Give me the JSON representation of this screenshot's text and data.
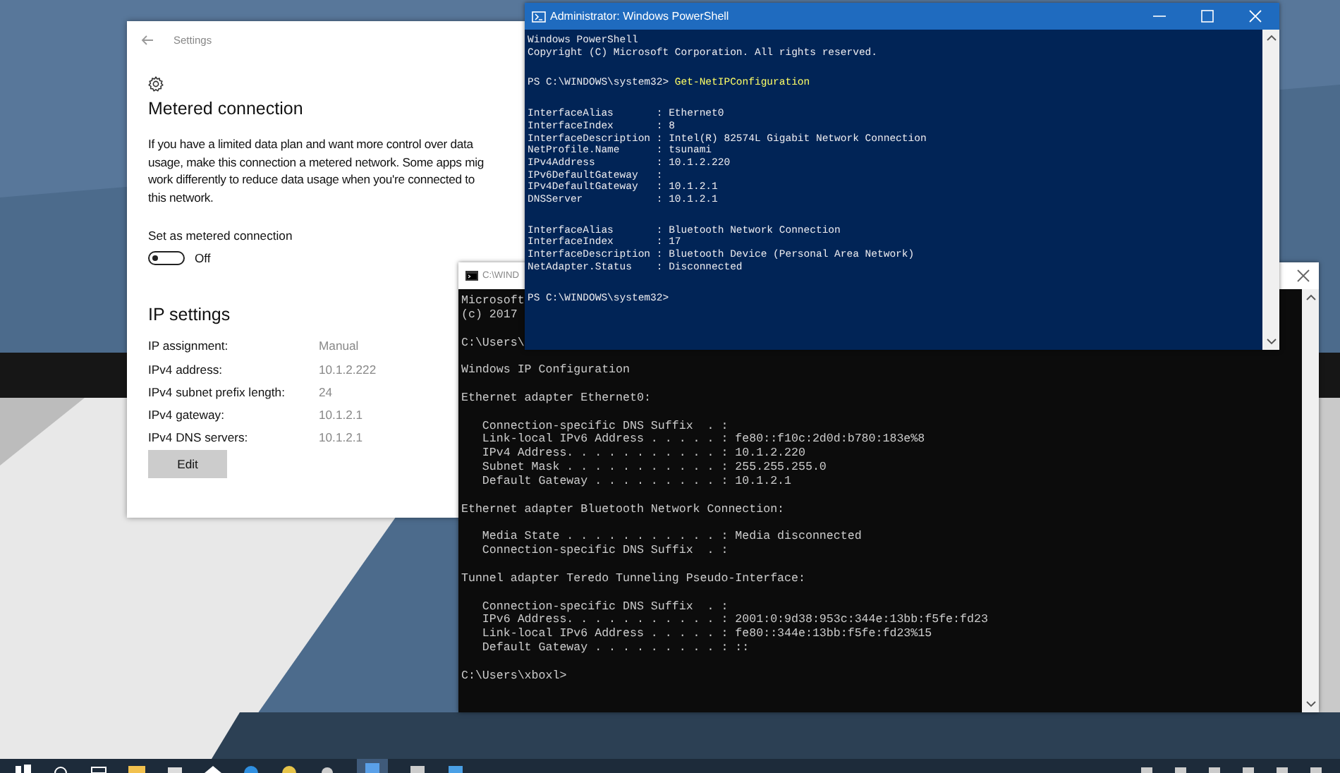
{
  "settings_window": {
    "title": "Settings",
    "heading": "Metered connection",
    "description_lines": [
      "If you have a limited data plan and want more control over data",
      "usage, make this connection a metered network. Some apps mig",
      "work differently to reduce data usage when you're connected to",
      "this network."
    ],
    "metered_toggle": {
      "label": "Set as metered connection",
      "on": false,
      "state_text": "Off"
    },
    "ip_section": {
      "heading": "IP settings",
      "rows": [
        {
          "label": "IP assignment:",
          "value": "Manual"
        },
        {
          "label": "IPv4 address:",
          "value": "10.1.2.222"
        },
        {
          "label": "IPv4 subnet prefix length:",
          "value": "24"
        },
        {
          "label": "IPv4 gateway:",
          "value": "10.1.2.1"
        },
        {
          "label": "IPv4 DNS servers:",
          "value": "10.1.2.1"
        }
      ],
      "button": "Edit"
    }
  },
  "powershell_window": {
    "title": "Administrator: Windows PowerShell",
    "blocks": [
      [
        "Windows PowerShell",
        "Copyright (C) Microsoft Corporation. All rights reserved."
      ],
      [
        {
          "prompt": "PS C:\\WINDOWS\\system32>",
          "command": "Get-NetIPConfiguration"
        }
      ],
      [
        "InterfaceAlias       : Ethernet0",
        "InterfaceIndex       : 8",
        "InterfaceDescription : Intel(R) 82574L Gigabit Network Connection",
        "NetProfile.Name      : tsunami",
        "IPv4Address          : 10.1.2.220",
        "IPv6DefaultGateway   :",
        "IPv4DefaultGateway   : 10.1.2.1",
        "DNSServer            : 10.1.2.1"
      ],
      [
        "InterfaceAlias       : Bluetooth Network Connection",
        "InterfaceIndex       : 17",
        "InterfaceDescription : Bluetooth Device (Personal Area Network)",
        "NetAdapter.Status    : Disconnected"
      ],
      [
        {
          "prompt": "PS C:\\WINDOWS\\system32>"
        }
      ]
    ]
  },
  "cmd_window": {
    "title": "C:\\WIND",
    "blocks": [
      [
        "Microsoft",
        "(c) 2017"
      ],
      [
        "C:\\Users\\"
      ],
      [
        "Windows IP Configuration"
      ],
      [
        "Ethernet adapter Ethernet0:"
      ],
      [
        "   Connection-specific DNS Suffix  . :",
        "   Link-local IPv6 Address . . . . . : fe80::f10c:2d0d:b780:183e%8",
        "   IPv4 Address. . . . . . . . . . . : 10.1.2.220",
        "   Subnet Mask . . . . . . . . . . . : 255.255.255.0",
        "   Default Gateway . . . . . . . . . : 10.1.2.1"
      ],
      [
        "Ethernet adapter Bluetooth Network Connection:"
      ],
      [
        "   Media State . . . . . . . . . . . : Media disconnected",
        "   Connection-specific DNS Suffix  . :"
      ],
      [
        "Tunnel adapter Teredo Tunneling Pseudo-Interface:"
      ],
      [
        "   Connection-specific DNS Suffix  . :",
        "   IPv6 Address. . . . . . . . . . . : 2001:0:9d38:953c:344e:13bb:f5fe:fd23",
        "   Link-local IPv6 Address . . . . . : fe80::344e:13bb:f5fe:fd23%15",
        "   Default Gateway . . . . . . . . . : ::"
      ],
      [
        "C:\\Users\\xboxl>"
      ]
    ]
  }
}
